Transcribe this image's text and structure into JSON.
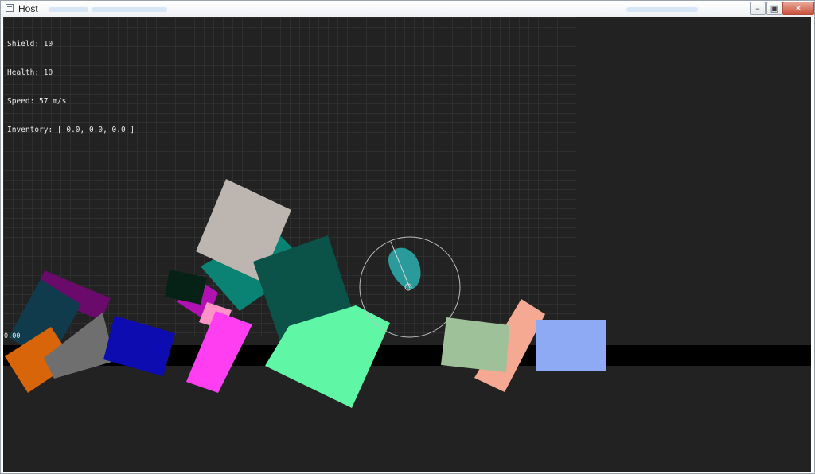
{
  "window": {
    "title": "Host",
    "controls": {
      "minimize_icon": "minimize-icon",
      "maximize_icon": "maximize-icon",
      "close_icon": "close-icon"
    }
  },
  "hud": {
    "shield": "Shield: 10",
    "health": "Health: 10",
    "speed": "Speed: 57 m/s",
    "inventory": "Inventory: [ 0.0, 0.0, 0.0 ]"
  },
  "coordinate_readout": "0.00",
  "colors": {
    "background": "#222222",
    "grid_line": "#3a3a3a",
    "ground_strip": "#000000",
    "player": "#2a9a9a",
    "range_ring": "#bdbdbd"
  },
  "scene": {
    "player": {
      "shape": "teardrop",
      "color": "#2a9a9a"
    },
    "range_ring": {
      "color": "#bdbdbd"
    },
    "blocks": [
      {
        "name": "purple-block",
        "color": "#6a0a6a"
      },
      {
        "name": "dark-teal-block",
        "color": "#0f3b4c"
      },
      {
        "name": "orange-block",
        "color": "#d8650a"
      },
      {
        "name": "gray-block",
        "color": "#6f6f6f"
      },
      {
        "name": "blue-block",
        "color": "#0c0cb0"
      },
      {
        "name": "magenta-block",
        "color": "#b312b3"
      },
      {
        "name": "light-pink-block",
        "color": "#ff93c8"
      },
      {
        "name": "pink-block",
        "color": "#ff3ef2"
      },
      {
        "name": "very-dark-green-block",
        "color": "#062216"
      },
      {
        "name": "teal-block",
        "color": "#0a8374"
      },
      {
        "name": "light-gray-block",
        "color": "#bdb6b0"
      },
      {
        "name": "dark-green-block",
        "color": "#0b5349"
      },
      {
        "name": "mint-green-block",
        "color": "#5ff6a6"
      },
      {
        "name": "salmon-block",
        "color": "#f5a992"
      },
      {
        "name": "sage-block",
        "color": "#9fc19a"
      },
      {
        "name": "periwinkle-block",
        "color": "#8eaaf5"
      }
    ]
  }
}
